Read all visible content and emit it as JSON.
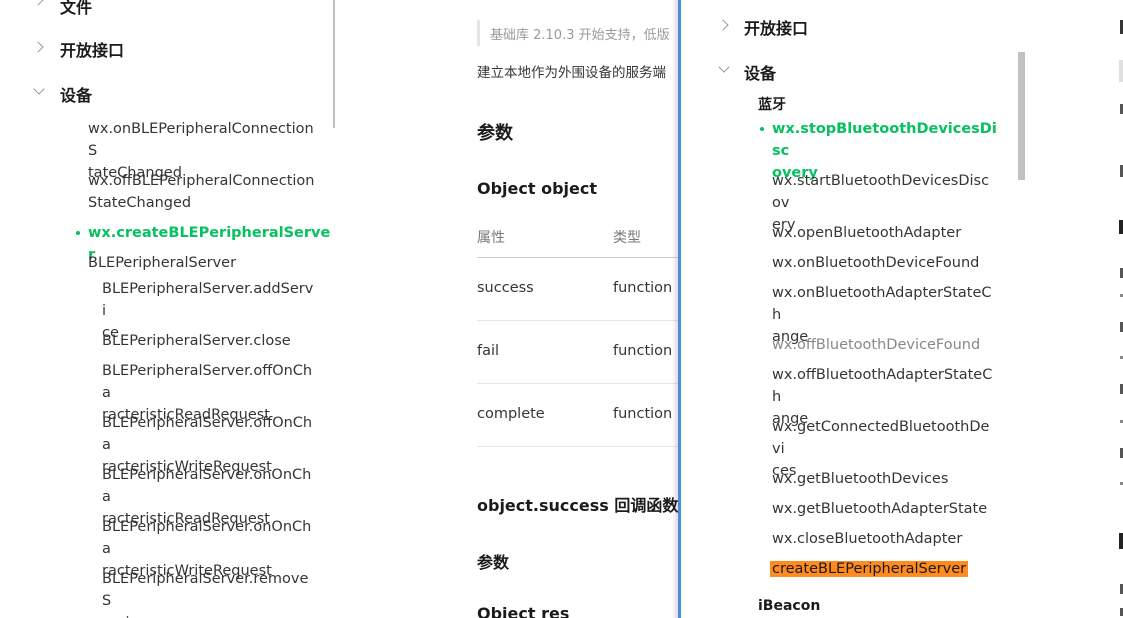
{
  "left_sidebar": {
    "top_partial": "文件",
    "open_api": "开放接口",
    "device": "设备",
    "items": [
      {
        "label": "wx.onBLEPeripheralConnectionStateChanged",
        "line1": "wx.onBLEPeripheralConnectionS",
        "line2": "tateChanged"
      },
      {
        "label": "wx.offBLEPeripheralConnectionStateChanged",
        "line1": "wx.offBLEPeripheralConnection",
        "line2": "StateChanged"
      },
      {
        "label": "wx.createBLEPeripheralServer"
      },
      {
        "label": "BLEPeripheralServer"
      },
      {
        "line1": "BLEPeripheralServer.addServi",
        "line2": "ce"
      },
      {
        "label": "BLEPeripheralServer.close"
      },
      {
        "line1": "BLEPeripheralServer.offOnCha",
        "line2": "racteristicReadRequest"
      },
      {
        "line1": "BLEPeripheralServer.offOnCha",
        "line2": "racteristicWriteRequest"
      },
      {
        "line1": "BLEPeripheralServer.onOnCha",
        "line2": "racteristicReadRequest"
      },
      {
        "line1": "BLEPeripheralServer.onOnCha",
        "line2": "racteristicWriteRequest"
      },
      {
        "line1": "BLEPeripheralServer.removeS",
        "line2": "ervice"
      }
    ]
  },
  "doc": {
    "note": "基础库 2.10.3 开始支持，低版",
    "description": "建立本地作为外围设备的服务端",
    "params_heading": "参数",
    "object_heading": "Object object",
    "table_headers": [
      "属性",
      "类型"
    ],
    "rows": [
      {
        "name": "success",
        "type": "function"
      },
      {
        "name": "fail",
        "type": "function"
      },
      {
        "name": "complete",
        "type": "function"
      }
    ],
    "callback_heading": "object.success 回调函数",
    "params_heading2": "参数",
    "object_res": "Object res"
  },
  "panel": {
    "open_api": "开放接口",
    "device": "设备",
    "bluetooth": "蓝牙",
    "items": [
      {
        "line1": "wx.stopBluetoothDevicesDisc",
        "line2": "overy"
      },
      {
        "line1": "wx.startBluetoothDevicesDiscov",
        "line2": "ery"
      },
      {
        "label": "wx.openBluetoothAdapter"
      },
      {
        "label": "wx.onBluetoothDeviceFound"
      },
      {
        "line1": "wx.onBluetoothAdapterStateCh",
        "line2": "ange"
      },
      {
        "label": "wx.offBluetoothDeviceFound"
      },
      {
        "line1": "wx.offBluetoothAdapterStateCh",
        "line2": "ange"
      },
      {
        "line1": "wx.getConnectedBluetoothDevi",
        "line2": "ces"
      },
      {
        "label": "wx.getBluetoothDevices"
      },
      {
        "label": "wx.getBluetoothAdapterState"
      },
      {
        "label": "wx.closeBluetoothAdapter"
      },
      {
        "label": "createBLEPeripheralServer"
      }
    ],
    "ibeacon": "iBeacon"
  },
  "colors": {
    "accent": "#07c160",
    "highlight": "#ff8a1f"
  }
}
